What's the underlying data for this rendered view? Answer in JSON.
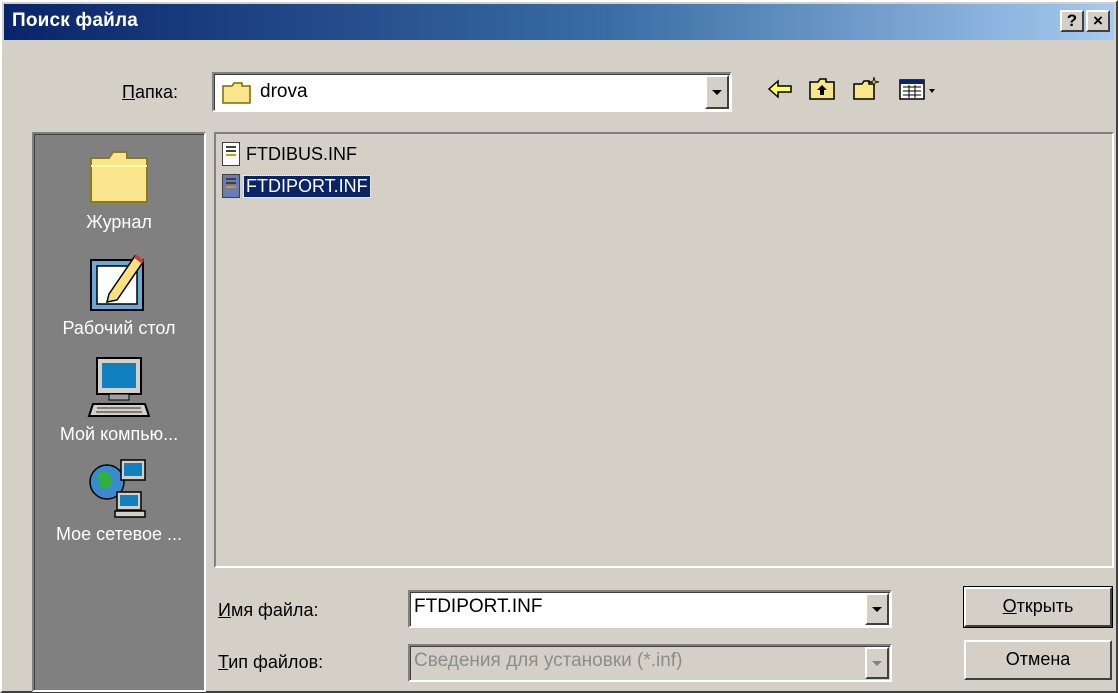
{
  "window": {
    "title": "Поиск файла",
    "help_label": "?",
    "close_label": "×"
  },
  "lookin": {
    "label_accel": "П",
    "label_rest": "апка:",
    "value": "drova"
  },
  "toolbar": {
    "back_icon": "back-arrow-icon",
    "up_icon": "up-folder-icon",
    "new_folder_icon": "new-folder-icon",
    "view_icon": "view-menu-icon"
  },
  "places": [
    {
      "label": "Журнал",
      "icon": "history-folder-icon"
    },
    {
      "label": "Рабочий стол",
      "icon": "desktop-icon"
    },
    {
      "label": "Мой компью...",
      "icon": "my-computer-icon"
    },
    {
      "label": "Мое сетевое ...",
      "icon": "network-places-icon"
    }
  ],
  "files": [
    {
      "name": "FTDIBUS.INF",
      "selected": false
    },
    {
      "name": "FTDIPORT.INF",
      "selected": true
    }
  ],
  "filename": {
    "label_accel": "И",
    "label_rest": "мя файла:",
    "value": "FTDIPORT.INF"
  },
  "filetype": {
    "label_accel": "Т",
    "label_rest": "ип файлов:",
    "value": "Сведения для установки (*.inf)"
  },
  "buttons": {
    "open_accel": "О",
    "open_rest": "ткрыть",
    "cancel": "Отмена"
  },
  "colors": {
    "face": "#d4d0c8",
    "title_start": "#0a246a",
    "title_end": "#a6caf0",
    "selection": "#0a246a"
  }
}
